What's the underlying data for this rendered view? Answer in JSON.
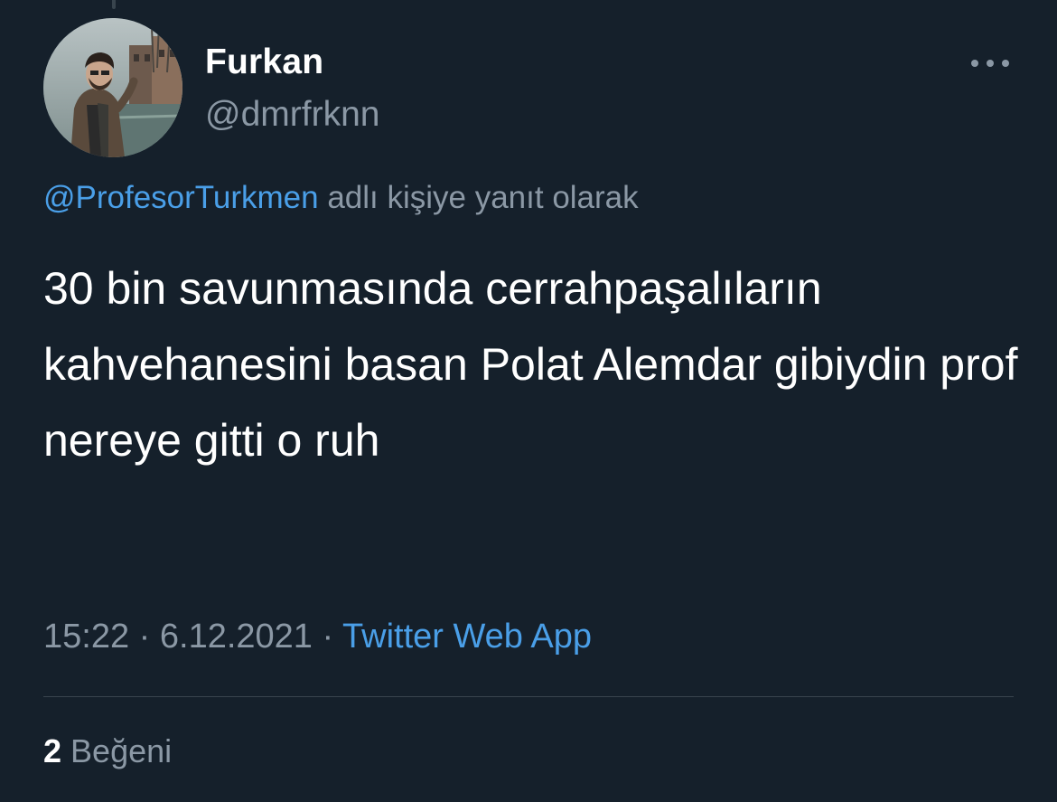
{
  "author": {
    "display_name": "Furkan",
    "handle": "@dmrfrknn"
  },
  "reply_context": {
    "mention": "@ProfesorTurkmen",
    "suffix": " adlı kişiye yanıt olarak"
  },
  "tweet": {
    "text": "30 bin savunmasında cerrahpaşalıların kahvehanesini basan Polat Alemdar gibiydin prof nereye gitti o ruh"
  },
  "meta": {
    "time": "15:22",
    "separator": " · ",
    "date": "6.12.2021",
    "source": "Twitter Web App"
  },
  "stats": {
    "likes_count": "2",
    "likes_label": " Beğeni"
  },
  "icons": {
    "more": "more-horizontal-icon"
  },
  "colors": {
    "background": "#15202b",
    "primary_text": "#ffffff",
    "secondary_text": "#8b98a5",
    "link": "#4a9fe8",
    "divider": "#38444d"
  }
}
